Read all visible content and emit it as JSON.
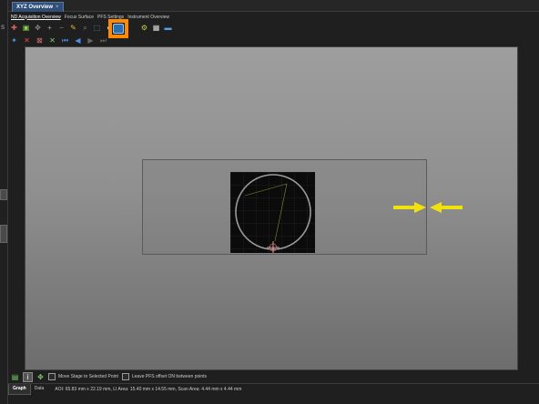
{
  "window": {
    "tab_title": "XYZ Overview",
    "close_glyph": "×"
  },
  "subtabs": [
    "ND Acquisition Overview",
    "Focus Surface",
    "PFS Settings",
    "Instrument Overview"
  ],
  "left_strip": {
    "labels": [
      "S",
      "≡",
      "≡"
    ]
  },
  "toolbar1": {
    "icons": [
      "add-point-icon",
      "select-region-icon",
      "move-icon",
      "add-icon",
      "remove-icon",
      "draw-icon",
      "zoom-icon",
      "fit-icon",
      "overview-icon",
      "scan-icon",
      "settings-icon",
      "camera-icon",
      "monitor-icon"
    ],
    "highlighted": "overview-scan-icon"
  },
  "toolbar2": {
    "icons": [
      "move-to-icon",
      "delete-icon",
      "clear-icon",
      "clear-all-icon",
      "first-icon",
      "previous-icon",
      "next-icon",
      "last-icon"
    ]
  },
  "colors": {
    "highlight": "#ff8a00",
    "arrow": "#f2e20c",
    "viewport_top": "#9e9e9e",
    "viewport_bottom": "#6d6d6d"
  },
  "bottom_bar": {
    "move_stage_label": "Move Stage to Selected Point",
    "leave_pfs_label": "Leave PFS offset ON between points"
  },
  "status_bar": {
    "tabs": [
      "Graph",
      "Data"
    ],
    "active_tab": "Graph",
    "text": "AOI: 65.83 mm x 22.19 mm, LI Area: 15.40 mm x 14.55 mm, Scan Area: 4.44 mm x 4.44 mm"
  }
}
